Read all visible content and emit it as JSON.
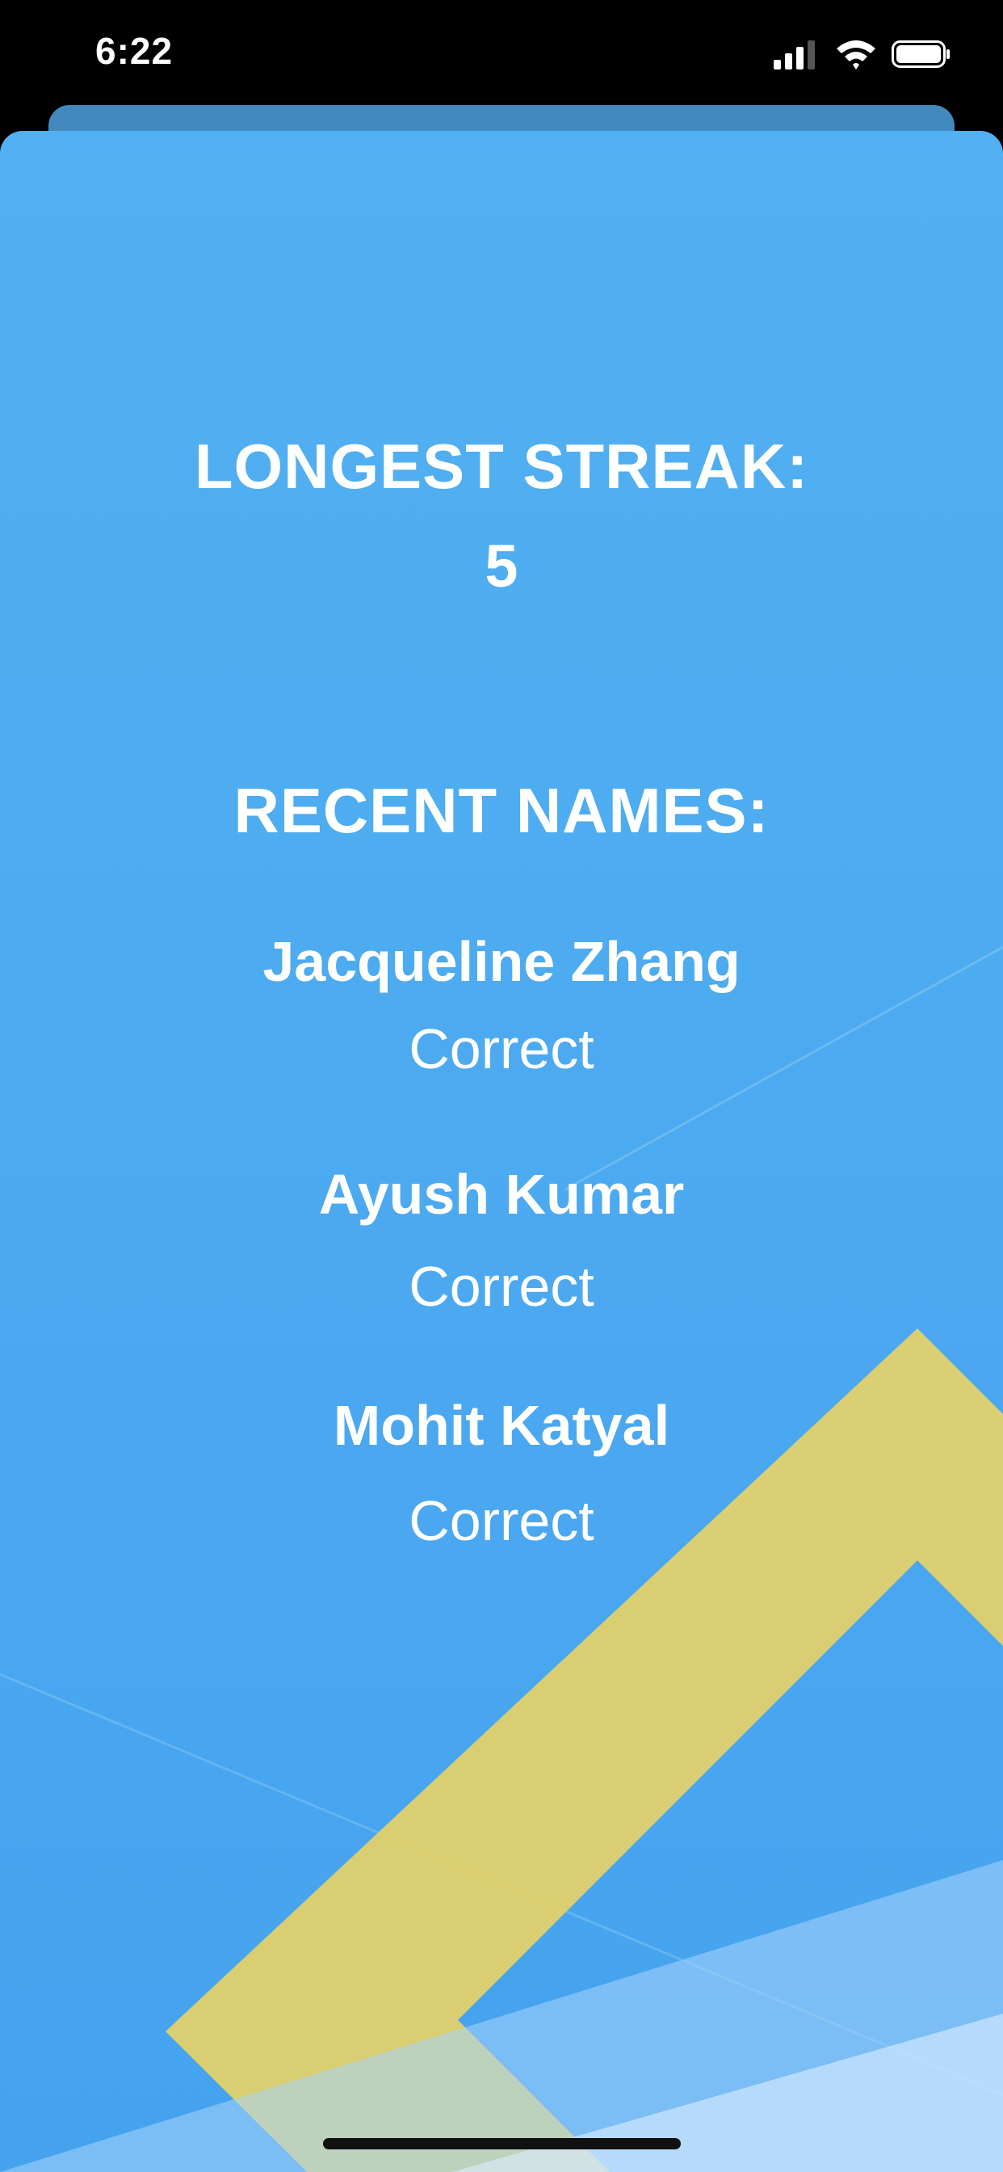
{
  "status_bar": {
    "time": "6:22",
    "signal_icon": "cellular-signal-icon",
    "wifi_icon": "wifi-icon",
    "battery_icon": "battery-icon"
  },
  "stats": {
    "streak_label": "LONGEST STREAK:",
    "streak_value": "5",
    "recent_label": "RECENT NAMES:"
  },
  "recent_names": [
    {
      "name": "Jacqueline Zhang",
      "result": "Correct"
    },
    {
      "name": "Ayush Kumar",
      "result": "Correct"
    },
    {
      "name": "Mohit Katyal",
      "result": "Correct"
    }
  ],
  "colors": {
    "background": "#4ca9f0",
    "accent_yellow": "#e2d16a",
    "text": "#ffffff"
  }
}
